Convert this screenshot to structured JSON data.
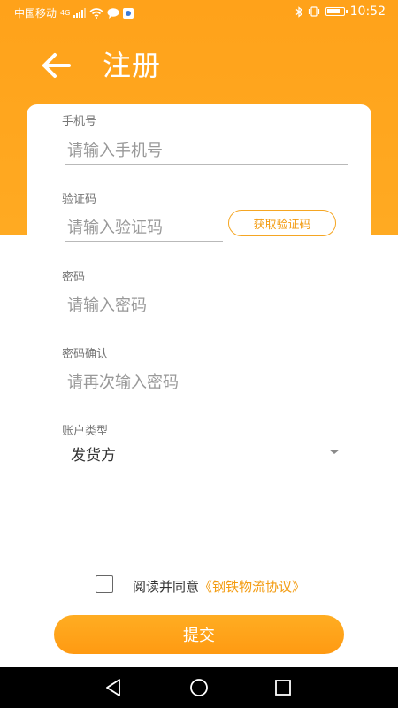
{
  "status_bar": {
    "carrier": "中国移动",
    "network": "4G",
    "time": "10:52",
    "battery_level": 0.85
  },
  "header": {
    "title": "注册"
  },
  "form": {
    "phone": {
      "label": "手机号",
      "placeholder": "请输入手机号",
      "value": ""
    },
    "code": {
      "label": "验证码",
      "placeholder": "请输入验证码",
      "value": "",
      "button_label": "获取验证码"
    },
    "password": {
      "label": "密码",
      "placeholder": "请输入密码",
      "value": ""
    },
    "password_confirm": {
      "label": "密码确认",
      "placeholder": "请再次输入密码",
      "value": ""
    },
    "account_type": {
      "label": "账户类型",
      "selected": "发货方"
    }
  },
  "agreement": {
    "checked": false,
    "prefix": "阅读并同意",
    "link": "《钢铁物流协议》"
  },
  "submit_label": "提交",
  "colors": {
    "accent": "#ffa21a",
    "link": "#f39c12"
  }
}
